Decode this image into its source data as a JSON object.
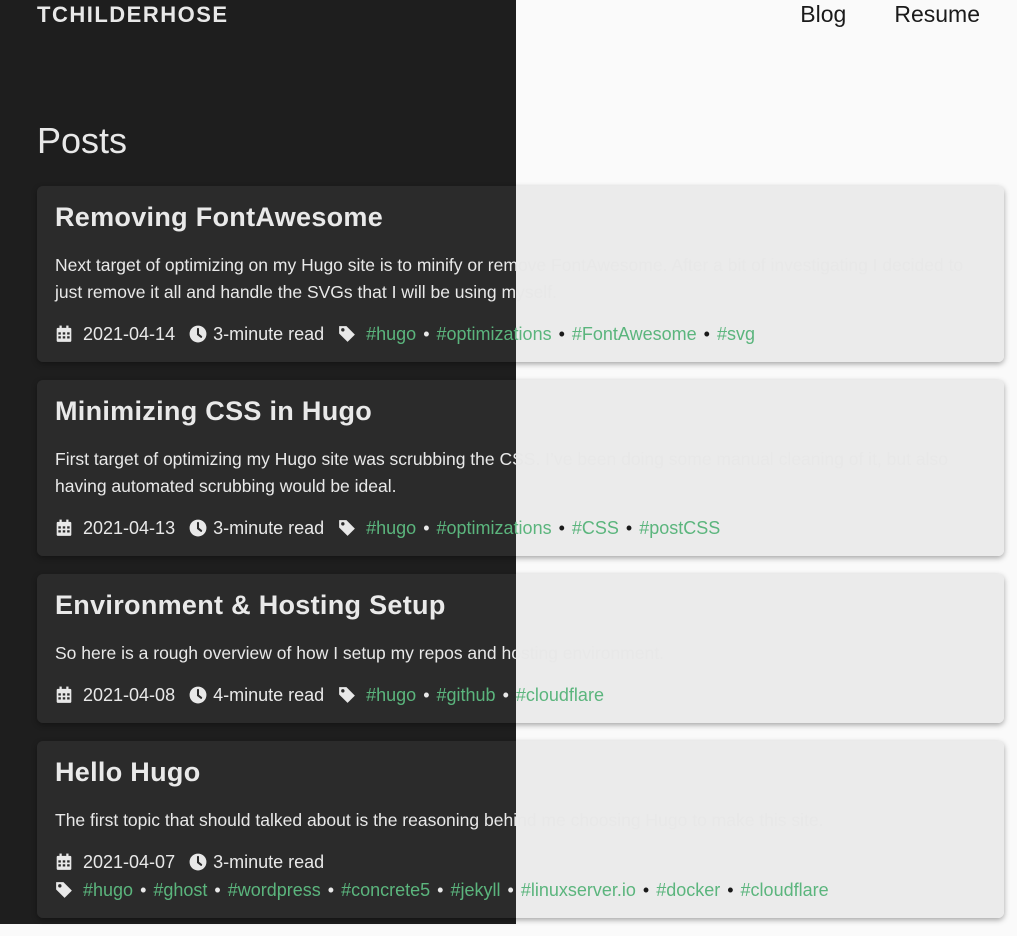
{
  "site": {
    "brand": "TCHILDERHOSE"
  },
  "nav": [
    {
      "label": "Blog"
    },
    {
      "label": "Resume"
    }
  ],
  "page": {
    "title": "Posts"
  },
  "posts": [
    {
      "title": "Removing FontAwesome",
      "summary": "Next target of optimizing on my Hugo site is to minify or remove FontAwesome. After a bit of investigating I decided to just remove it all and handle the SVGs that I will be using myself.",
      "date": "2021-04-14",
      "read": "3-minute read",
      "tags": [
        "#hugo",
        "#optimizations",
        "#FontAwesome",
        "#svg"
      ]
    },
    {
      "title": "Minimizing CSS in Hugo",
      "summary": "First target of optimizing my Hugo site was scrubbing the CSS. I’ve been doing some manual cleaning of it, but also having automated scrubbing would be ideal.",
      "date": "2021-04-13",
      "read": "3-minute read",
      "tags": [
        "#hugo",
        "#optimizations",
        "#CSS",
        "#postCSS"
      ]
    },
    {
      "title": "Environment & Hosting Setup",
      "summary": "So here is a rough overview of how I setup my repos and hosting environment.",
      "date": "2021-04-08",
      "read": "4-minute read",
      "tags": [
        "#hugo",
        "#github",
        "#cloudflare"
      ]
    },
    {
      "title": "Hello Hugo",
      "summary": "The first topic that should talked about is the reasoning behind me choosing Hugo to make this site.",
      "date": "2021-04-07",
      "read": "3-minute read",
      "tags": [
        "#hugo",
        "#ghost",
        "#wordpress",
        "#concrete5",
        "#jekyll",
        "#linuxserver.io",
        "#docker",
        "#cloudflare"
      ]
    }
  ],
  "icons": {
    "date": "calendar-icon",
    "read": "clock-icon",
    "tags": "tag-icon"
  },
  "colors": {
    "dark_bg": "#1e1e1e",
    "card_dark": "#2b2b2b",
    "card_light": "#ebebeb",
    "tag": "#5bb57d"
  }
}
